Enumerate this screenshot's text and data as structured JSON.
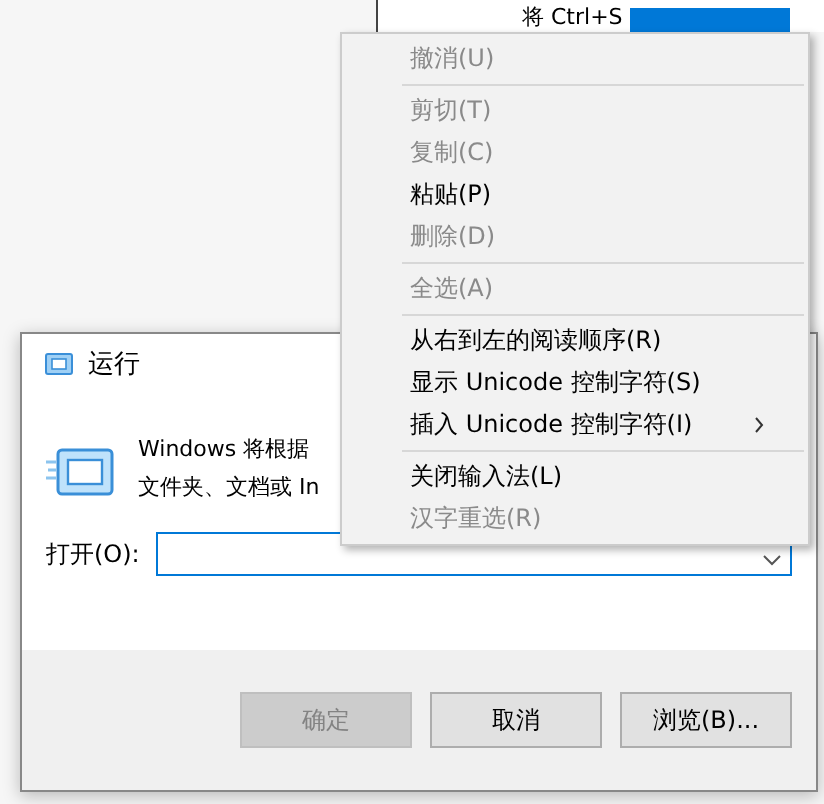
{
  "document": {
    "text": "将 Ctrl+S"
  },
  "run_dialog": {
    "title": "运行",
    "description": [
      "Windows 将根据",
      "文件夹、文档或 In"
    ],
    "open_label": "打开(O):",
    "buttons": [
      {
        "label": "确定",
        "disabled": true
      },
      {
        "label": "取消",
        "disabled": false
      },
      {
        "label": "浏览(B)...",
        "disabled": false
      }
    ]
  },
  "context_menu": {
    "items": [
      {
        "kind": "item",
        "label": "撤消(U)",
        "disabled": true
      },
      {
        "kind": "separator"
      },
      {
        "kind": "item",
        "label": "剪切(T)",
        "disabled": true
      },
      {
        "kind": "item",
        "label": "复制(C)",
        "disabled": true
      },
      {
        "kind": "item",
        "label": "粘贴(P)",
        "disabled": false
      },
      {
        "kind": "item",
        "label": "删除(D)",
        "disabled": true
      },
      {
        "kind": "separator"
      },
      {
        "kind": "item",
        "label": "全选(A)",
        "disabled": true
      },
      {
        "kind": "separator"
      },
      {
        "kind": "item",
        "label": "从右到左的阅读顺序(R)",
        "disabled": false
      },
      {
        "kind": "item",
        "label": "显示 Unicode 控制字符(S)",
        "disabled": false
      },
      {
        "kind": "submenu",
        "label": "插入 Unicode 控制字符(I)",
        "disabled": false
      },
      {
        "kind": "separator"
      },
      {
        "kind": "item",
        "label": "关闭输入法(L)",
        "disabled": false
      },
      {
        "kind": "item",
        "label": "汉字重选(R)",
        "disabled": true
      }
    ]
  }
}
